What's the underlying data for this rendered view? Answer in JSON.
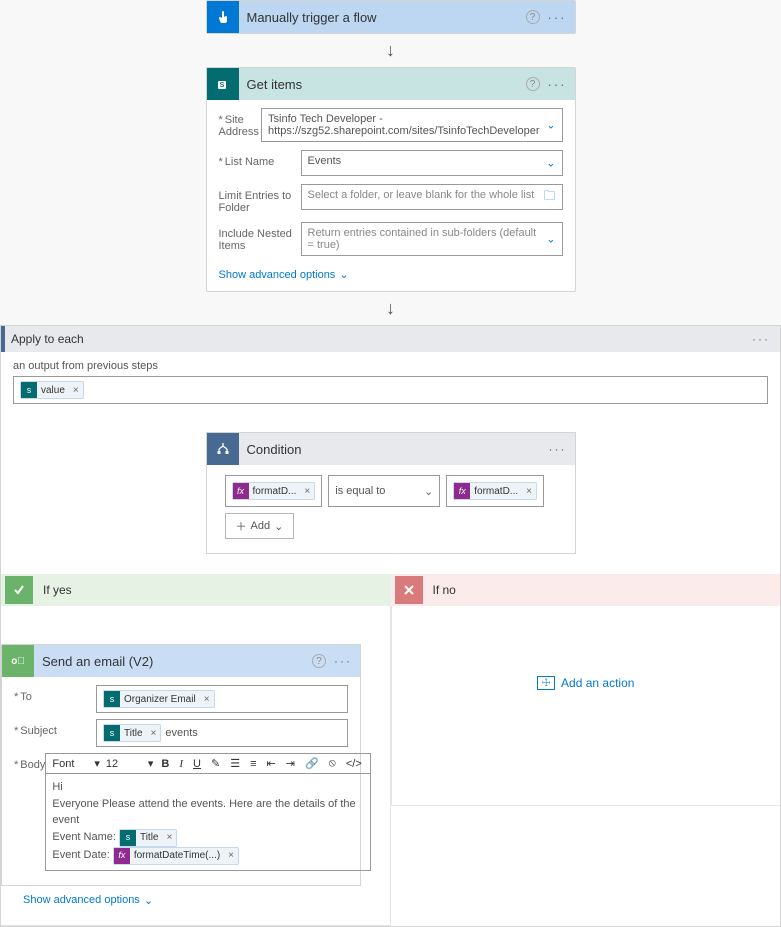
{
  "trigger": {
    "title": "Manually trigger a flow"
  },
  "getitems": {
    "title": "Get items",
    "fields": {
      "site_label": "Site Address",
      "site_value": "Tsinfo Tech Developer - https://szg52.sharepoint.com/sites/TsinfoTechDeveloper",
      "list_label": "List Name",
      "list_value": "Events",
      "folder_label": "Limit Entries to Folder",
      "folder_placeholder": "Select a folder, or leave blank for the whole list",
      "nested_label": "Include Nested Items",
      "nested_placeholder": "Return entries contained in sub-folders (default = true)"
    },
    "show_advanced": "Show advanced options"
  },
  "apply": {
    "title": "Apply to each",
    "label": "an output from previous steps",
    "token": "value"
  },
  "condition": {
    "title": "Condition",
    "left_token": "formatD...",
    "operator": "is equal to",
    "right_token": "formatD...",
    "add": "Add"
  },
  "branches": {
    "yes": "If yes",
    "no": "If no",
    "add_action": "Add an action"
  },
  "email": {
    "title": "Send an email (V2)",
    "to_label": "To",
    "to_token": "Organizer Email",
    "subject_label": "Subject",
    "subject_token": "Title",
    "subject_text": "events",
    "body_label": "Body",
    "font_label": "Font",
    "font_size": "12",
    "body_line1": "Hi",
    "body_line2": "Everyone Please attend the events. Here are the details of the event",
    "body_line3_label": "Event Name:",
    "body_line3_token": "Title",
    "body_line4_label": "Event Date:",
    "body_line4_token": "formatDateTime(...)",
    "show_advanced": "Show advanced options"
  }
}
